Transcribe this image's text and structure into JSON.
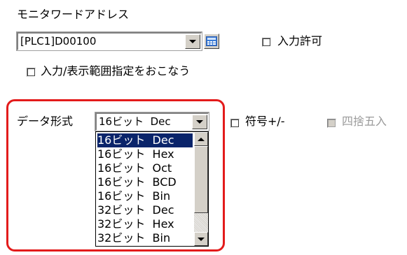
{
  "monitor": {
    "label": "モニタワードアドレス",
    "address_value": "[PLC1]D00100",
    "keypad_icon": "keypad-icon",
    "input_allow_label": "入力許可"
  },
  "range": {
    "label": "入力/表示範囲指定をおこなう"
  },
  "format": {
    "label": "データ形式",
    "selected": "16ビット  Dec",
    "sign_label": "符号+/-",
    "round_label": "四捨五入",
    "options": [
      "16ビット  Dec",
      "16ビット  Hex",
      "16ビット  Oct",
      "16ビット  BCD",
      "16ビット  Bin",
      "32ビット  Dec",
      "32ビット  Hex",
      "32ビット  Bin"
    ]
  },
  "colors": {
    "highlight": "#e31b1b",
    "selection": "#0a246a"
  }
}
